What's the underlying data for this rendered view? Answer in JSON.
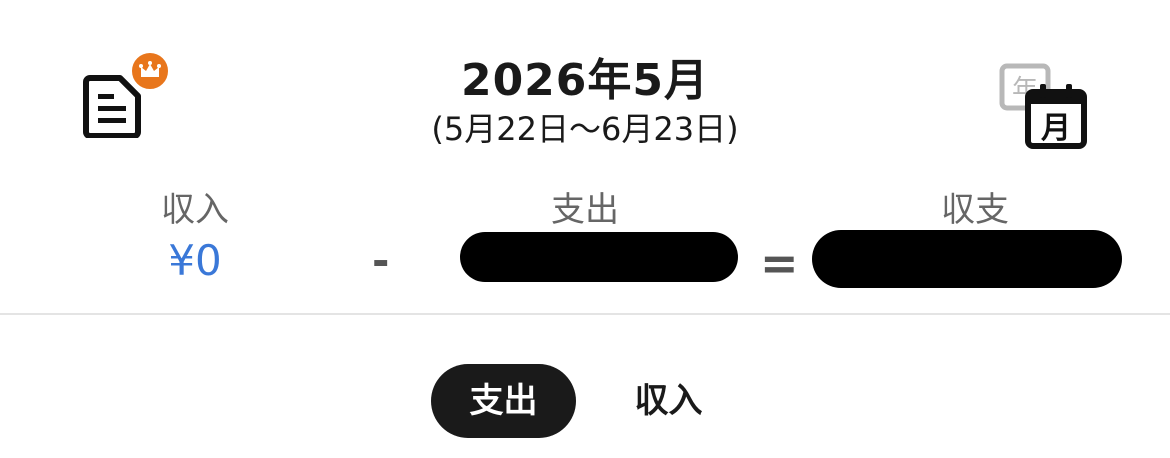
{
  "header": {
    "title": "2026年5月",
    "period": "(5月22日〜6月23日)",
    "report_icon": "report-document-icon",
    "crown_icon": "crown-icon",
    "calendar_icon": "calendar-month-icon",
    "calendar_year_glyph": "年",
    "calendar_month_glyph": "月"
  },
  "summary": {
    "income_label": "収入",
    "income_value": "¥0",
    "minus": "-",
    "expense_label": "支出",
    "equals": "=",
    "balance_label": "収支"
  },
  "tabs": [
    {
      "label": "支出",
      "active": true
    },
    {
      "label": "収入",
      "active": false
    }
  ],
  "colors": {
    "income": "#3a78d8",
    "badge": "#e8761c",
    "tab_active_bg": "#1a1a1a"
  }
}
